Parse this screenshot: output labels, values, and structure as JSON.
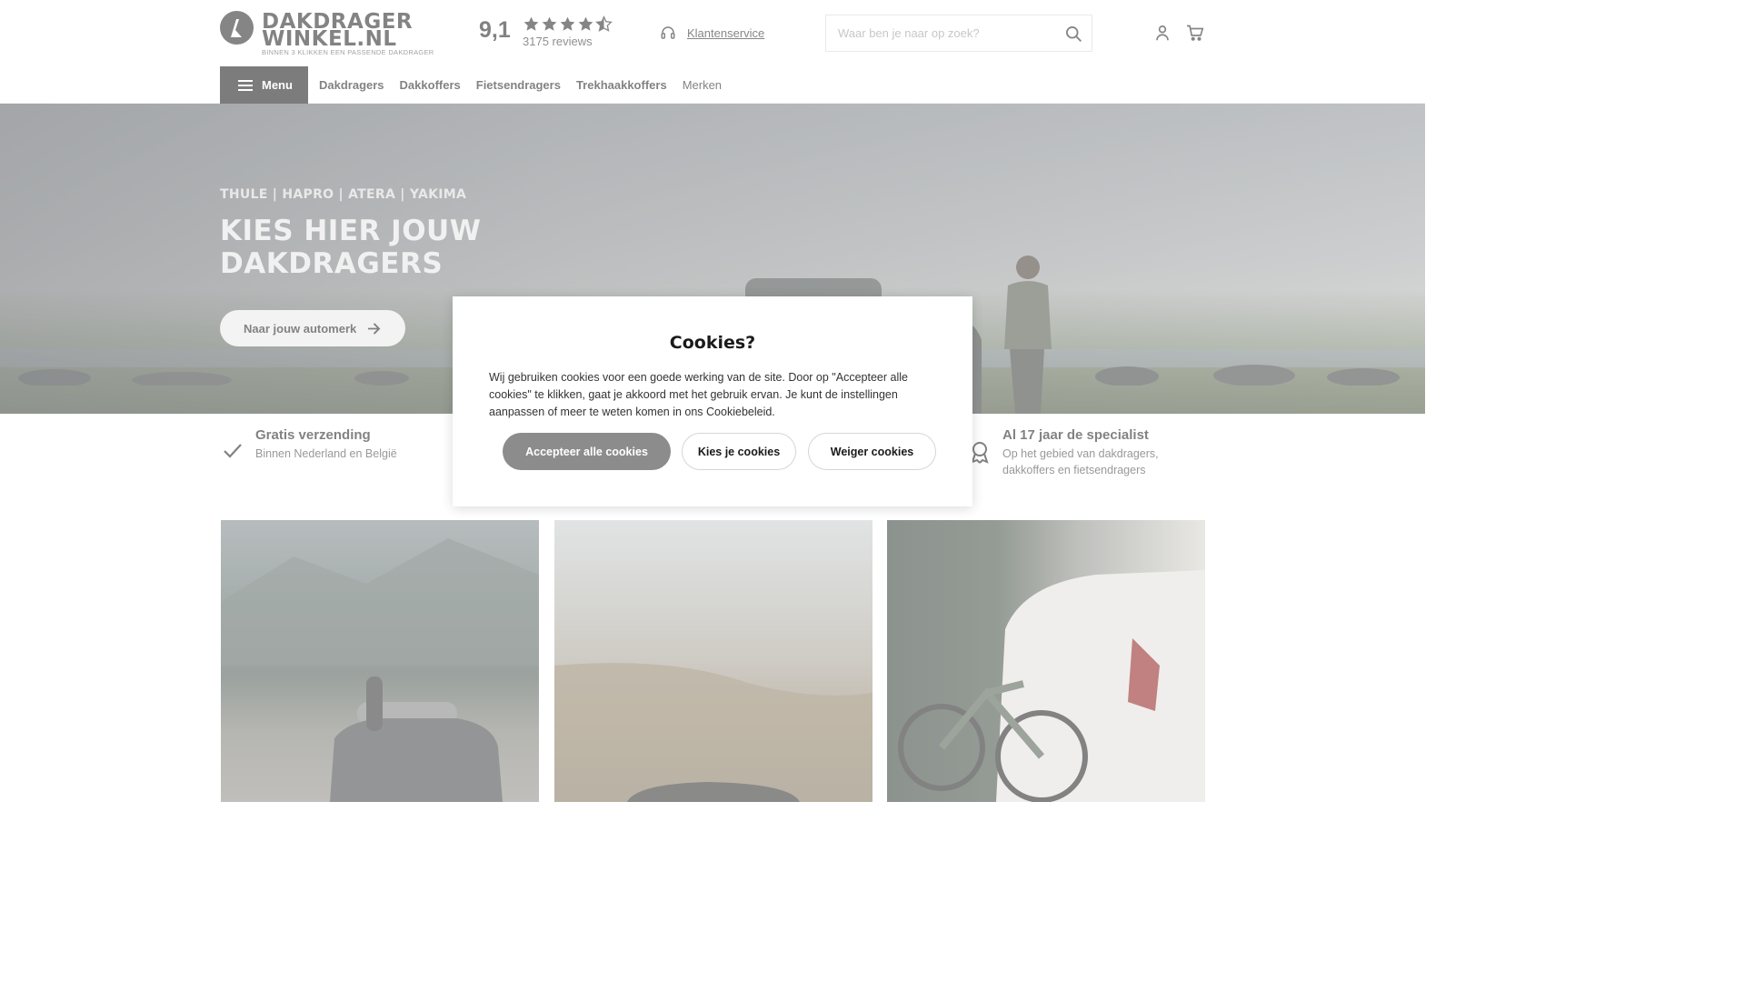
{
  "header": {
    "logo": {
      "line1": "DAKDRAGER",
      "line2": "WINKEL.NL",
      "tagline": "BINNEN 3 KLIKKEN EEN PASSENDE DAKDRAGER"
    },
    "rating": {
      "score": "9,1",
      "reviews": "3175 reviews",
      "stars_filled": 4.5,
      "stars_total": 5,
      "star_color": "#222222"
    },
    "service": {
      "label": "Klantenservice",
      "icon": "headset-icon"
    },
    "search": {
      "placeholder": "Waar ben je naar op zoek?",
      "value": "",
      "icon": "search-icon"
    },
    "icons": {
      "account": "user-icon",
      "cart": "cart-icon"
    }
  },
  "nav": {
    "menu_label": "Menu",
    "links": [
      {
        "label": "Dakdragers"
      },
      {
        "label": "Dakkoffers"
      },
      {
        "label": "Fietsendragers"
      },
      {
        "label": "Trekhaakkoffers"
      },
      {
        "label": "Merken"
      }
    ]
  },
  "hero": {
    "brands": "THULE | HAPRO | ATERA | YAKIMA",
    "title": "KIES HIER JOUW DAKDRAGERS",
    "cta_label": "Naar jouw automerk"
  },
  "usps": [
    {
      "title": "Gratis verzending",
      "subtitle": "Binnen Nederland en België",
      "icon": "check-icon"
    },
    {
      "title": "Al 17 jaar de specialist",
      "subtitle": "Op het gebied van dakdragers, dakkoffers en fietsendragers",
      "icon": "award-icon"
    }
  ],
  "cookie_modal": {
    "title": "Cookies?",
    "text": "Wij gebruiken cookies voor een goede werking van de site. Door op \"Accepteer alle cookies\" te klikken, gaat je akkoord met het gebruik ervan. Je kunt de instellingen aanpassen of meer te weten komen in ons Cookiebeleid.",
    "accept_label": "Accepteer alle cookies",
    "choose_label": "Kies je cookies",
    "deny_label": "Weiger cookies",
    "accept_color": "#8c8c8c"
  }
}
